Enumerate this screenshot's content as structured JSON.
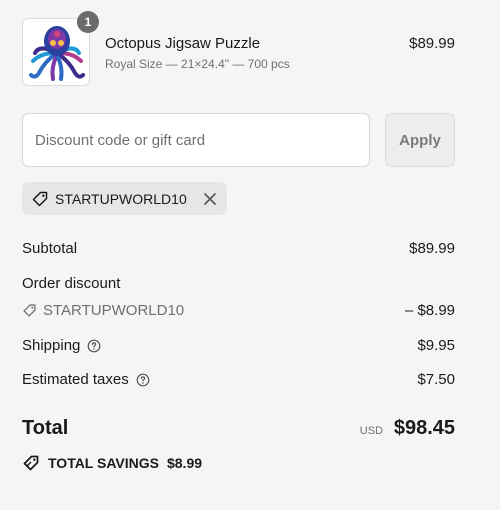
{
  "product": {
    "quantity": "1",
    "name": "Octopus Jigsaw Puzzle",
    "variant": "Royal Size — 21×24.4\" — 700 pcs",
    "price": "$89.99",
    "thumbnail_icon": "octopus-puzzle-image"
  },
  "discount": {
    "placeholder": "Discount code or gift card",
    "value": "",
    "apply_label": "Apply",
    "applied_code": "STARTUPWORLD10"
  },
  "summary": {
    "subtotal_label": "Subtotal",
    "subtotal_value": "$89.99",
    "order_discount_label": "Order discount",
    "discount_code": "STARTUPWORLD10",
    "discount_value": "– $8.99",
    "shipping_label": "Shipping",
    "shipping_value": "$9.95",
    "taxes_label": "Estimated taxes",
    "taxes_value": "$7.50"
  },
  "total": {
    "label": "Total",
    "currency": "USD",
    "amount": "$98.45"
  },
  "savings": {
    "label": "TOTAL SAVINGS",
    "amount": "$8.99"
  },
  "colors": {
    "background": "#f5f5f5",
    "text": "#1a1a1a",
    "muted": "#707070",
    "badge": "#6b6b6b"
  }
}
